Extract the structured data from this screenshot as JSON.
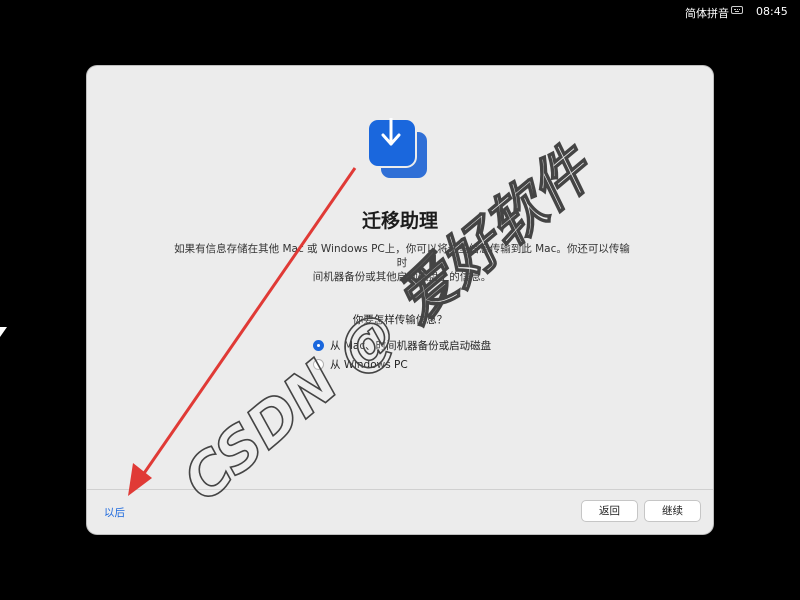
{
  "menubar": {
    "input_method": "简体拼音",
    "clock": "08:45"
  },
  "window": {
    "title": "迁移助理",
    "description_line1": "如果有信息存储在其他 Mac 或 Windows PC上，你可以将这些信息传输到此 Mac。你还可以传输时",
    "description_line2": "间机器备份或其他启动磁盘上的信息。",
    "question": "你要怎样传输信息？",
    "options": [
      {
        "label": "从 Mac、时间机器备份或启动磁盘",
        "selected": true
      },
      {
        "label": "从 Windows PC",
        "selected": false
      }
    ],
    "later_label": "以后",
    "back_label": "返回",
    "continue_label": "继续"
  },
  "watermark": {
    "text": "CSDN @ 爱好软件"
  },
  "colors": {
    "accent": "#1a67dd",
    "window_bg": "#ececec",
    "arrow": "#e03a36"
  },
  "icons": {
    "app_icon": "migration-assistant-icon",
    "keyboard": "keyboard-icon"
  }
}
